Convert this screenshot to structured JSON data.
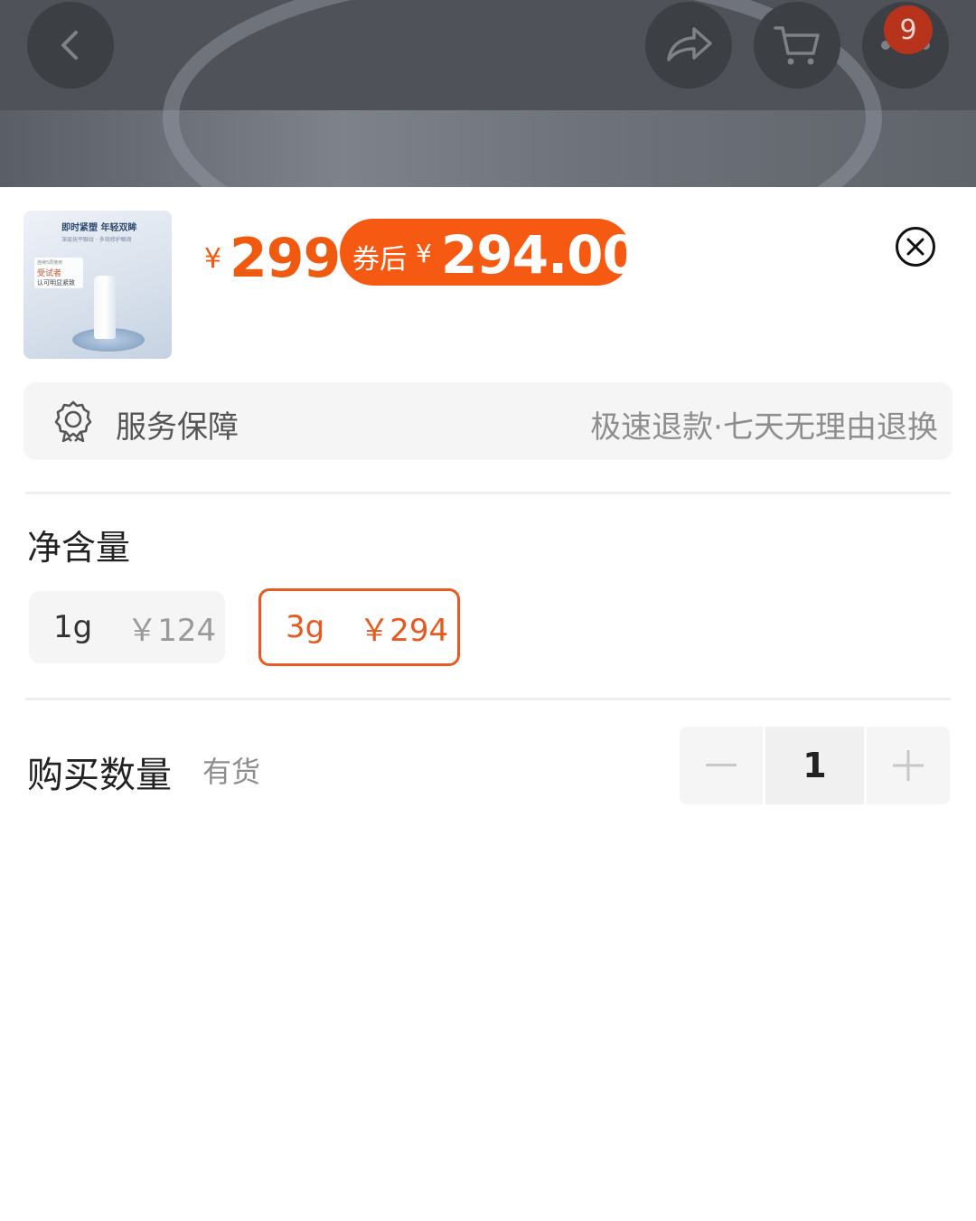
{
  "topbar": {
    "back_icon": "chevron-left-icon",
    "share_icon": "share-arrow-icon",
    "cart_icon": "shopping-cart-icon",
    "more_icon": "more-dots-icon",
    "badge_count": "9"
  },
  "product": {
    "thumbnail_lines": [
      "即时紧塑 年轻双眸",
      "深层抚平眼纹 · 多效修护眼周",
      "连续5周使用",
      "受试者",
      "认可明显紧致"
    ],
    "price_currency": "¥",
    "price": "299",
    "coupon_label": "券后",
    "coupon_currency": "¥",
    "coupon_price": "294.00",
    "close_icon": "close-circle-icon"
  },
  "service": {
    "icon": "award-badge-icon",
    "title": "服务保障",
    "tags": "极速退款·七天无理由退换"
  },
  "spec": {
    "title": "净含量",
    "options": [
      {
        "name": "1g",
        "price": "￥124",
        "selected": false
      },
      {
        "name": "3g",
        "price": "￥294",
        "selected": true
      }
    ]
  },
  "quantity": {
    "label": "购买数量",
    "stock": "有货",
    "minus": "−",
    "value": "1",
    "plus": "+"
  },
  "colors": {
    "accent": "#f05a10",
    "coupon_bg": "#f65a12",
    "badge": "#b8331c"
  }
}
